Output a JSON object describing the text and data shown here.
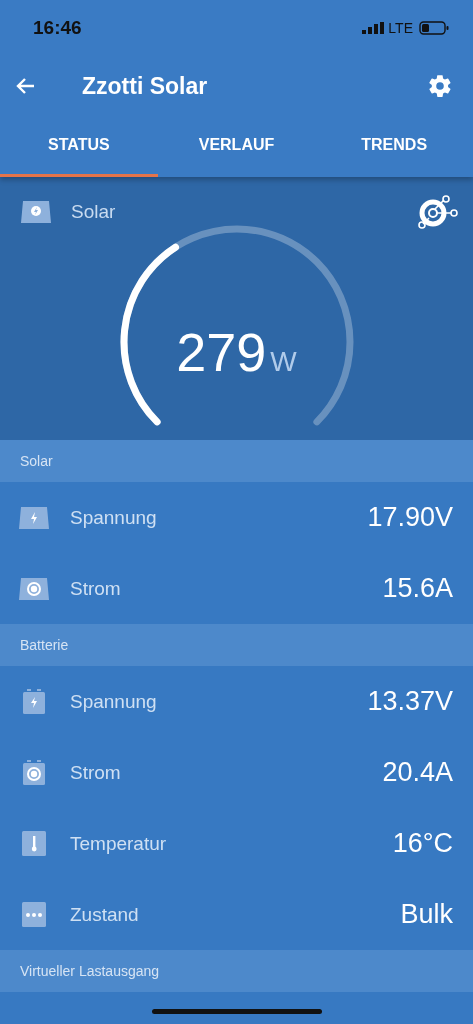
{
  "status_bar": {
    "time": "16:46",
    "network": "LTE"
  },
  "app_bar": {
    "title": "Zzotti Solar"
  },
  "tabs": [
    {
      "label": "STATUS",
      "selected": true
    },
    {
      "label": "VERLAUF",
      "selected": false
    },
    {
      "label": "TRENDS",
      "selected": false
    }
  ],
  "gauge": {
    "label": "Solar",
    "value": "279",
    "unit": "W"
  },
  "sections": [
    {
      "title": "Solar",
      "rows": [
        {
          "kind": "solar-voltage",
          "label": "Spannung",
          "value": "17.90V"
        },
        {
          "kind": "solar-current",
          "label": "Strom",
          "value": "15.6A"
        }
      ]
    },
    {
      "title": "Batterie",
      "rows": [
        {
          "kind": "battery-voltage",
          "label": "Spannung",
          "value": "13.37V"
        },
        {
          "kind": "battery-current",
          "label": "Strom",
          "value": "20.4A"
        },
        {
          "kind": "temperature",
          "label": "Temperatur",
          "value": "16°C"
        },
        {
          "kind": "state",
          "label": "Zustand",
          "value": "Bulk"
        }
      ]
    },
    {
      "title": "Virtueller Lastausgang"
    }
  ]
}
